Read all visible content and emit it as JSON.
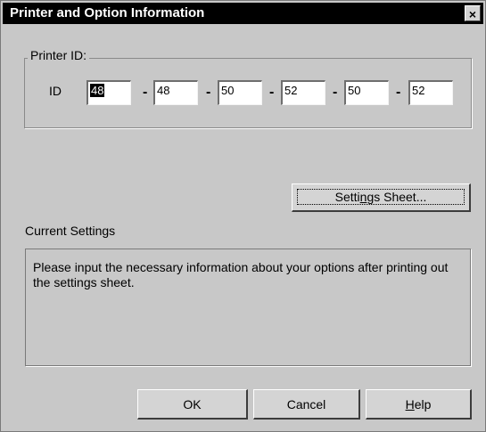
{
  "window": {
    "title": "Printer and Option Information",
    "close_symbol": "×",
    "close_icon": "close-icon"
  },
  "printer_id": {
    "group_label": "Printer ID:",
    "id_label": "ID",
    "separator": "-",
    "fields": [
      "48",
      "48",
      "50",
      "52",
      "50",
      "52"
    ],
    "selected_field_index": 0
  },
  "settings_sheet_button": {
    "pre": "Setti",
    "mnemonic": "n",
    "post": "gs Sheet..."
  },
  "current_settings": {
    "label": "Current Settings",
    "message": "Please input the necessary information about your options after printing out the settings sheet."
  },
  "buttons": {
    "ok": "OK",
    "cancel": "Cancel",
    "help_mnemonic": "H",
    "help_rest": "elp"
  },
  "colors": {
    "dialog_bg": "#c8c8c8",
    "titlebar_bg": "#000000",
    "titlebar_text": "#ffffff"
  }
}
